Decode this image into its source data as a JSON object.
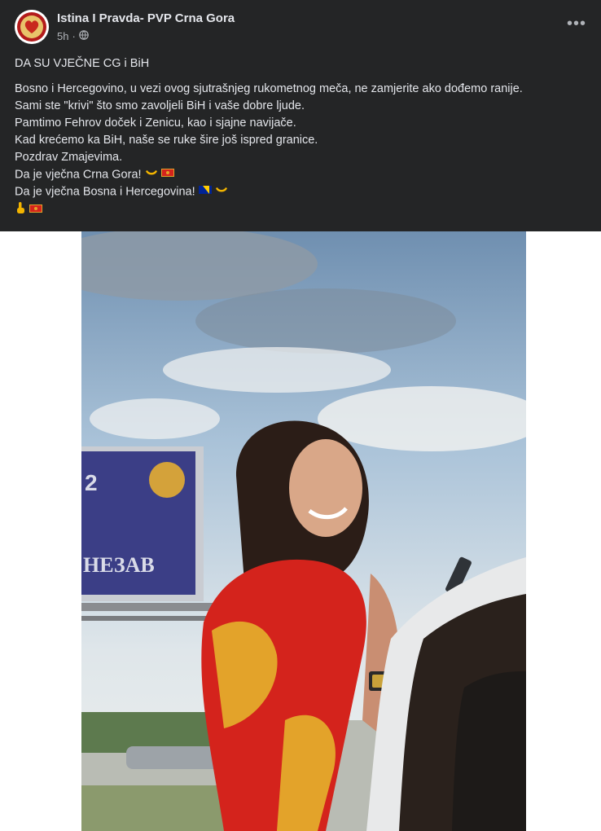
{
  "post": {
    "author": "Istina I Pravda- PVP Crna Gora",
    "time": "5h",
    "dot": "·",
    "more": "•••",
    "title": "DA SU VJEČNE CG i BiH",
    "lines": [
      "Bosno i Hercegovino, u vezi ovog sjutrašnjeg rukometnog meča, ne zamjerite ako dođemo ranije.",
      "Sami ste \"krivi\" što smo zavoljeli BiH i vaše dobre ljude.",
      "Pamtimo Fehrov doček i Zenicu, kao i sjajne navijače.",
      "Kad krećemo ka BiH, naše se ruke šire još ispred granice.",
      "Pozdrav Zmajevima.",
      "Da je vječna Crna Gora!",
      "Da je vječna Bosna i Hercegovina!"
    ]
  },
  "icons": {
    "globe": "globe-icon",
    "hug": "open-hands-icon",
    "flag_me": "montenegro-flag-icon",
    "flag_ba": "bosnia-flag-icon",
    "finger": "index-finger-icon"
  },
  "photo": {
    "billboard_number": "2",
    "billboard_text": "НЕЗАВ"
  },
  "colors": {
    "background": "#242526",
    "text": "#e4e6eb",
    "secondary": "#b0b3b8",
    "flag_red": "#d4231c",
    "flag_gold": "#e3a32a"
  }
}
